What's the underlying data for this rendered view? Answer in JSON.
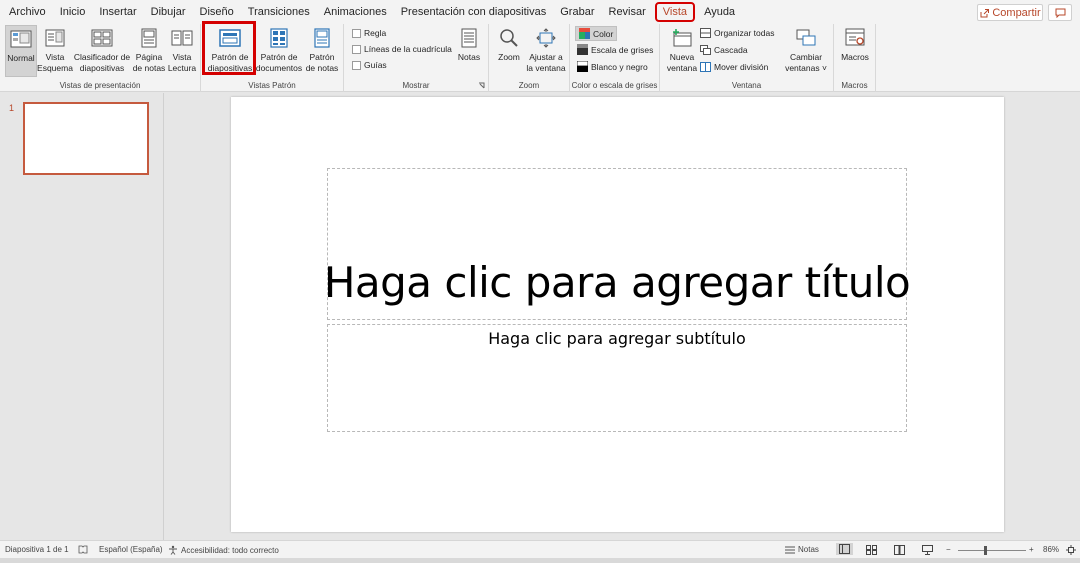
{
  "menu": {
    "tabs": [
      "Archivo",
      "Inicio",
      "Insertar",
      "Dibujar",
      "Diseño",
      "Transiciones",
      "Animaciones",
      "Presentación con diapositivas",
      "Grabar",
      "Revisar",
      "Vista",
      "Ayuda"
    ],
    "active_tab": "Vista",
    "share_label": "Compartir"
  },
  "ribbon": {
    "groups": {
      "vistas_presentacion": {
        "label": "Vistas de presentación",
        "normal": "Normal",
        "esquema": [
          "Vista",
          "Esquema"
        ],
        "clasificador": [
          "Clasificador de",
          "diapositivas"
        ],
        "pagina_notas": [
          "Página",
          "de notas"
        ],
        "vista_lectura": [
          "Vista",
          "Lectura"
        ]
      },
      "vistas_patron": {
        "label": "Vistas Patrón",
        "patron_diapositivas": [
          "Patrón de",
          "diapositivas"
        ],
        "patron_documentos": [
          "Patrón de",
          "documentos"
        ],
        "patron_notas": [
          "Patrón",
          "de notas"
        ]
      },
      "mostrar": {
        "label": "Mostrar",
        "regla": "Regla",
        "lineas": "Líneas de la cuadrícula",
        "guias": "Guías",
        "notas": "Notas"
      },
      "zoom": {
        "label": "Zoom",
        "zoom": "Zoom",
        "ajustar": [
          "Ajustar a",
          "la ventana"
        ]
      },
      "color": {
        "label": "Color o escala de grises",
        "color": "Color",
        "escala": "Escala de grises",
        "blanco_negro": "Blanco y negro"
      },
      "ventana": {
        "label": "Ventana",
        "nueva": [
          "Nueva",
          "ventana"
        ],
        "organizar": "Organizar todas",
        "cascada": "Cascada",
        "mover": "Mover división",
        "cambiar": [
          "Cambiar",
          "ventanas"
        ]
      },
      "macros": {
        "label": "Macros",
        "macros": "Macros"
      }
    }
  },
  "thumbnails": {
    "slide_number": "1"
  },
  "slide": {
    "title_placeholder": "Haga clic para agregar título",
    "subtitle_placeholder": "Haga clic para agregar subtítulo"
  },
  "status": {
    "slide_info": "Diapositiva 1 de 1",
    "language": "Español (España)",
    "accessibility": "Accesibilidad: todo correcto",
    "notes": "Notas",
    "zoom": "86%",
    "zoom_fraction": 0.86
  },
  "colors": {
    "accent": "#b7472a",
    "highlight": "#d40000"
  }
}
